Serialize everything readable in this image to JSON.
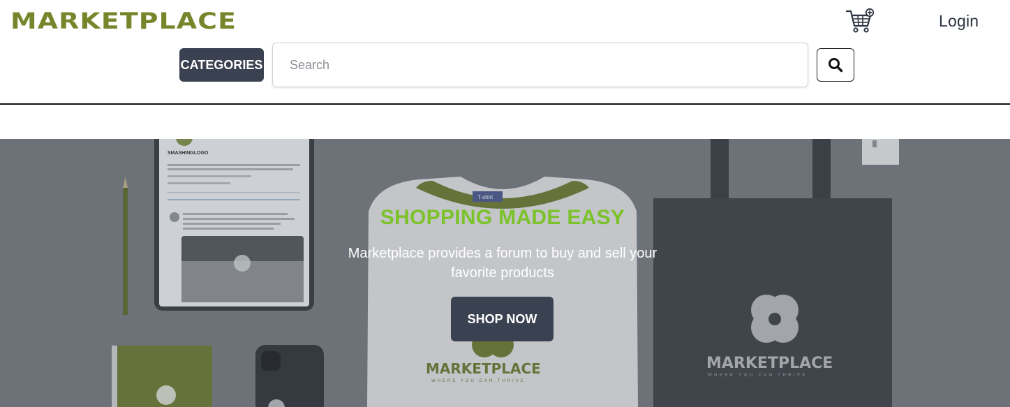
{
  "brand": {
    "logo_text": "MARKETPLACE",
    "color": "#76872b"
  },
  "header": {
    "cart_icon": "shopping-cart-plus-icon",
    "login_label": "Login",
    "categories_label": "CATEGORIES",
    "search_placeholder": "Search",
    "search_value": "",
    "search_icon": "search-icon"
  },
  "hero": {
    "title": "SHOPPING MADE EASY",
    "title_color": "#7cc22a",
    "description": "Marketplace provides a forum to buy and sell your favorite products",
    "cta_label": "SHOP NOW",
    "image_texts": {
      "profile_name": "SMASHINGLOGO",
      "tshirt_tag": "T-shirt",
      "tshirt_logo": "MARKETPLACE",
      "tshirt_tagline": "WHERE YOU CAN THRIVE",
      "bag_logo": "MARKETPLACE",
      "bag_tagline": "WHERE YOU CAN THRIVE"
    }
  },
  "colors": {
    "button_dark": "#3a4150",
    "text_dark": "#2d3440"
  }
}
